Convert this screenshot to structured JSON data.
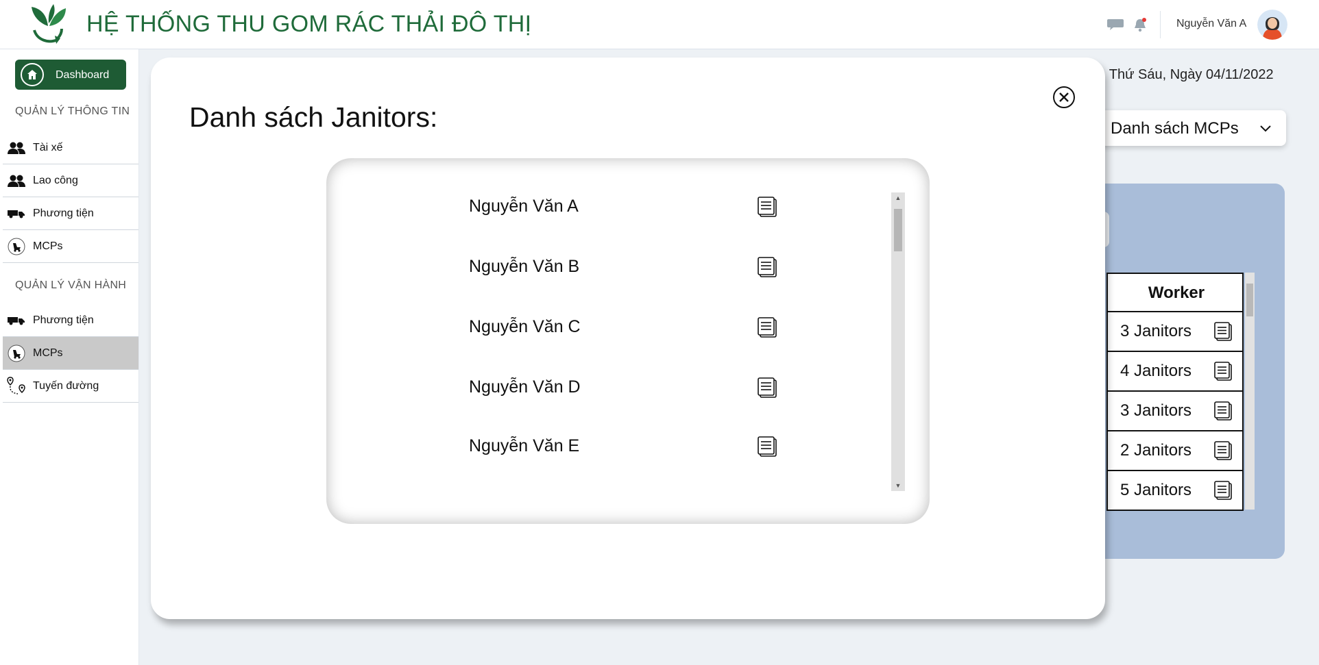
{
  "header": {
    "app_title": "HỆ THỐNG THU GOM RÁC THẢI ĐÔ THỊ",
    "user_name": "Nguyễn Văn A",
    "brand_color": "#1f6b3a"
  },
  "sidebar": {
    "dashboard_label": "Dashboard",
    "section_info": "QUẢN LÝ THÔNG TIN",
    "info_items": [
      {
        "label": "Tài xế",
        "icon": "users-icon"
      },
      {
        "label": "Lao công",
        "icon": "users-icon"
      },
      {
        "label": "Phương tiện",
        "icon": "truck-icon"
      },
      {
        "label": "MCPs",
        "icon": "mcp-icon"
      }
    ],
    "section_ops": "QUẢN LÝ VẬN HÀNH",
    "ops_items": [
      {
        "label": "Phương tiện",
        "icon": "truck-icon"
      },
      {
        "label": "MCPs",
        "icon": "mcp-icon",
        "active": true
      },
      {
        "label": "Tuyến đường",
        "icon": "route-icon"
      }
    ]
  },
  "background": {
    "date_text": ", Thứ Sáu, Ngày 04/11/2022",
    "dropdown_label": "Danh sách MCPs",
    "table": {
      "header": "Worker",
      "rows": [
        "3 Janitors",
        "4 Janitors",
        "3 Janitors",
        "2 Janitors",
        "5 Janitors"
      ]
    }
  },
  "modal": {
    "title": "Danh sách Janitors:",
    "janitors": [
      "Nguyễn Văn A",
      "Nguyễn Văn B",
      "Nguyễn Văn C",
      "Nguyễn Văn D",
      "Nguyễn Văn E"
    ]
  }
}
